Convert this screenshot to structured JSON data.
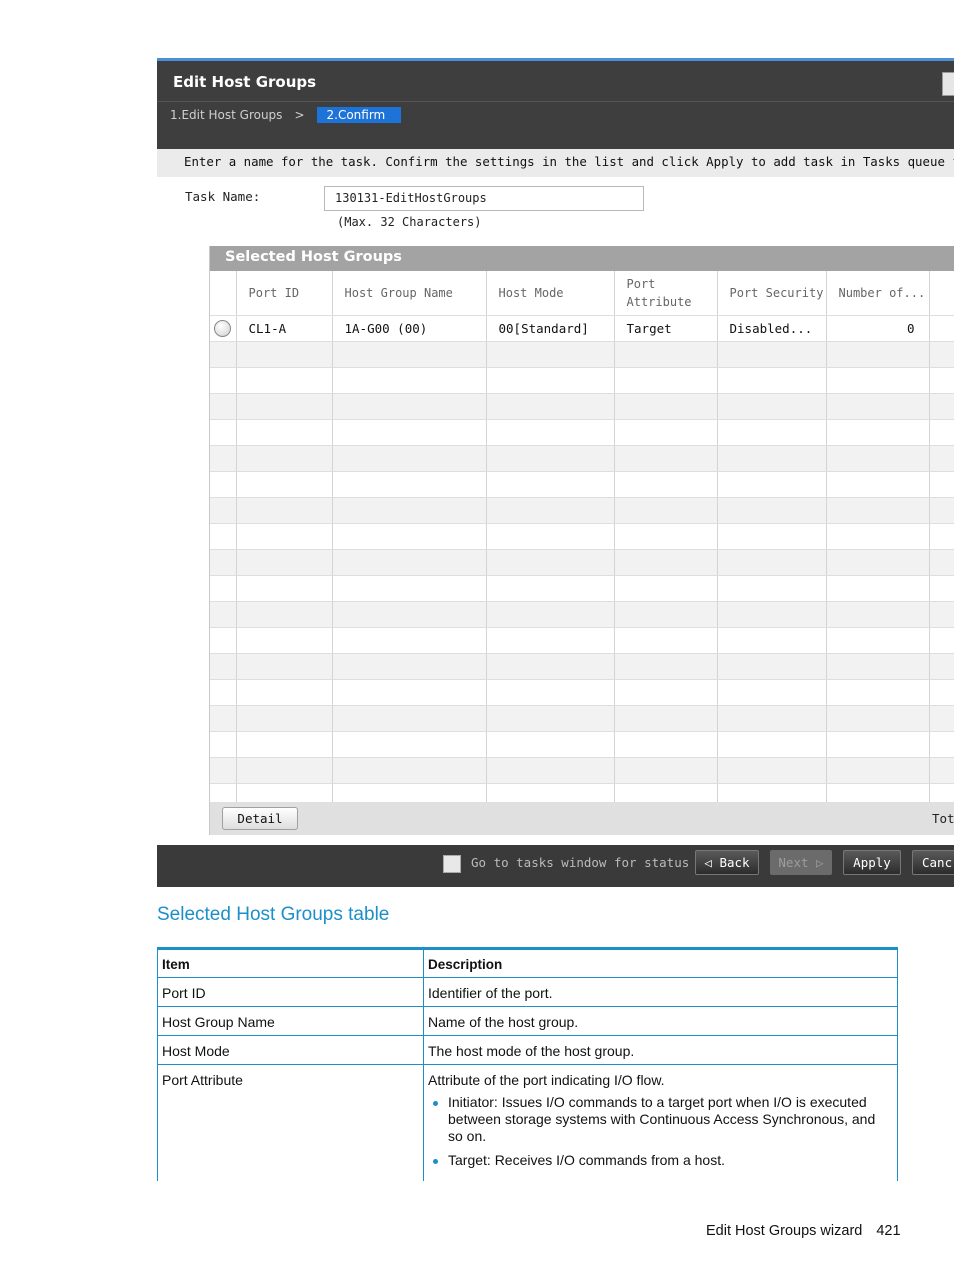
{
  "window": {
    "title": "Edit Host Groups",
    "steps": [
      "1.Edit Host Groups",
      "2.Confirm"
    ],
    "step_separator": ">",
    "instruction": "Enter a name for the task. Confirm the settings in the list and click Apply to add task in Tasks queue for ex",
    "task_name_label": "Task Name:",
    "task_name_value": "130131-EditHostGroups",
    "task_name_hint": "(Max. 32 Characters)",
    "panel_title": "Selected Host Groups",
    "columns": [
      "Port ID",
      "Host Group Name",
      "Host Mode",
      "Port Attribute",
      "Port Security",
      "Number of..."
    ],
    "rows": [
      [
        "CL1-A",
        "1A-G00 (00)",
        "00[Standard]",
        "Target",
        "Disabled...",
        "0"
      ]
    ],
    "detail_button": "Detail",
    "total_label": "Tot",
    "checkbox_label": "Go to tasks window for status",
    "buttons": {
      "back": "Back",
      "next": "Next",
      "apply": "Apply",
      "cancel": "Canc"
    }
  },
  "section_title": "Selected Host Groups table",
  "doc_table": {
    "headers": [
      "Item",
      "Description"
    ],
    "rows": [
      {
        "item": "Port ID",
        "description": "Identifier of the port."
      },
      {
        "item": "Host Group Name",
        "description": "Name of the host group."
      },
      {
        "item": "Host Mode",
        "description": "The host mode of the host group."
      },
      {
        "item": "Port Attribute",
        "description": "Attribute of the port indicating I/O flow.",
        "bullets": [
          "Initiator: Issues I/O commands to a target port when I/O is executed between storage systems with Continuous Access Synchronous, and so on.",
          "Target: Receives I/O commands from a host."
        ]
      }
    ]
  },
  "footer": {
    "text": "Edit Host Groups wizard",
    "page": "421"
  },
  "colors": {
    "accent": "#1c8fc9",
    "step_highlight": "#1e73d8",
    "dark_bar": "#3e3e3e"
  }
}
